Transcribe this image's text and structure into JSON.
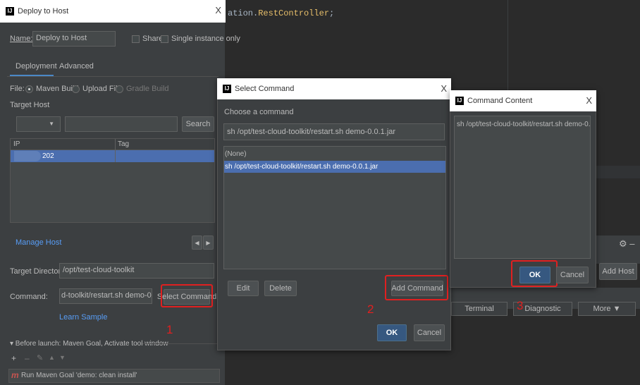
{
  "editor": {
    "code_prefix": "ation.",
    "code_class": "RestController",
    "code_suffix": ";"
  },
  "background_tool": {
    "gear_icon": "⚙ –",
    "add_host": "Add Host",
    "tabs": [
      "Terminal",
      "Diagnostic",
      "More ▼"
    ]
  },
  "deploy_dialog": {
    "title": "Deploy to Host",
    "close": "X",
    "name_label": "Name:",
    "name_value": "Deploy to Host",
    "share_label": "Share",
    "single_instance_label": "Single instance only",
    "tabs": [
      "Deployment",
      "Advanced"
    ],
    "file_label": "File:",
    "file_options": [
      "Maven Build",
      "Upload File",
      "Gradle Build"
    ],
    "target_host_label": "Target Host",
    "host_select_arrow": "▼",
    "search_value": "",
    "search_button": "Search",
    "table_headers": [
      "IP",
      "Tag"
    ],
    "table_rows": [
      {
        "ip": "202",
        "tag": ""
      }
    ],
    "manage_host": "Manage Host",
    "page_prev": "◀",
    "page_next": "▶",
    "target_dir_label": "Target Directory:",
    "target_dir_value": "/opt/test-cloud-toolkit",
    "command_label": "Command:",
    "command_value": "d-toolkit/restart.sh demo-0.0.1.jar",
    "select_command_button": "Select Command",
    "learn_sample": "Learn Sample",
    "before_launch": "▾ Before launch: Maven Goal, Activate tool window",
    "before_launch_tools": [
      "+",
      "–",
      "✎",
      "▲",
      "▼"
    ],
    "maven_goal_icon": "m",
    "maven_goal": "Run Maven Goal 'demo: clean install'"
  },
  "select_command_dialog": {
    "title": "Select Command",
    "close": "X",
    "prompt": "Choose a command",
    "selected_value": "sh /opt/test-cloud-toolkit/restart.sh demo-0.0.1.jar",
    "options": [
      "(None)",
      "sh /opt/test-cloud-toolkit/restart.sh demo-0.0.1.jar"
    ],
    "edit_button": "Edit",
    "delete_button": "Delete",
    "add_command_button": "Add Command",
    "ok_button": "OK",
    "cancel_button": "Cancel"
  },
  "command_content_dialog": {
    "title": "Command Content",
    "close": "X",
    "content": "sh /opt/test-cloud-toolkit/restart.sh demo-0.0.1.jar",
    "ok_button": "OK",
    "cancel_button": "Cancel"
  },
  "annotations": {
    "step1": "1",
    "step2": "2",
    "step3": "3"
  },
  "colors": {
    "accent": "#4b6eaf",
    "highlight": "#e02020",
    "link": "#589df6",
    "panel": "#3c3f41"
  }
}
